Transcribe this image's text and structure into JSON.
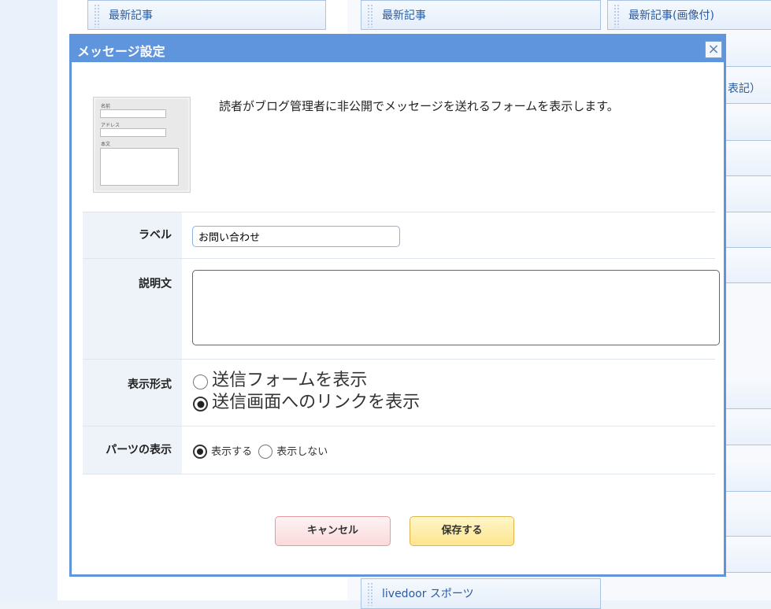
{
  "background": {
    "top_parts": [
      {
        "label": "最新記事"
      },
      {
        "label": "最新記事"
      },
      {
        "label": "最新記事(画像付)"
      }
    ],
    "right_partial_label": "表記）",
    "bottom_part": {
      "label": "livedoor スポーツ"
    }
  },
  "dialog": {
    "title": "メッセージ設定",
    "close_icon": "close-x-icon",
    "preview": {
      "name_label": "名前",
      "address_label": "アドレス",
      "body_label": "本文"
    },
    "description": "読者がブログ管理者に非公開でメッセージを送れるフォームを表示します。",
    "fields": {
      "label": {
        "header": "ラベル",
        "value": "お問い合わせ"
      },
      "explanation": {
        "header": "説明文",
        "value": ""
      },
      "display_format": {
        "header": "表示形式",
        "options": [
          {
            "label": "送信フォームを表示",
            "selected": false
          },
          {
            "label": "送信画面へのリンクを表示",
            "selected": true
          }
        ]
      },
      "parts_display": {
        "header": "パーツの表示",
        "options": [
          {
            "label": "表示する",
            "selected": true
          },
          {
            "label": "表示しない",
            "selected": false
          }
        ]
      }
    },
    "buttons": {
      "cancel": "キャンセル",
      "save": "保存する"
    }
  },
  "colors": {
    "dialog_header": "#5f95dd",
    "cancel_button": "#fbd9db",
    "save_button": "#fde58e"
  }
}
